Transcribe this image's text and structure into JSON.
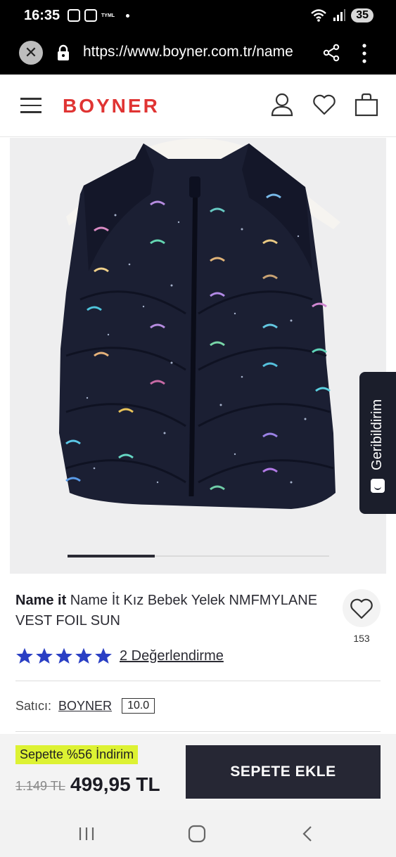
{
  "status_bar": {
    "time": "16:35",
    "carrier_small": "TYML",
    "battery": "35"
  },
  "browser": {
    "url": "https://www.boyner.com.tr/name"
  },
  "site_header": {
    "logo": "BOYNER"
  },
  "gallery": {
    "slide_index": 1,
    "slide_count": 3
  },
  "feedback": {
    "label": "Geribildirim"
  },
  "product": {
    "brand": "Name it",
    "title_rest": " Name İt Kız Bebek Yelek NMFMYLANE VEST FOIL SUN",
    "favorite_count": "153",
    "rating_stars": 5,
    "rating_link": "2 Değerlendirme",
    "seller_label": "Satıcı:",
    "seller_name": "BOYNER",
    "seller_score": "10.0"
  },
  "purchase": {
    "discount_text": "Sepette %56 İndirim",
    "old_price": "1.149 TL",
    "new_price": "499,95 TL",
    "add_to_cart": "SEPETE EKLE"
  },
  "colors": {
    "brand_red": "#e03433",
    "button_dark": "#262734",
    "star_blue": "#2a3fc4",
    "discount_highlight": "#ddf233"
  }
}
